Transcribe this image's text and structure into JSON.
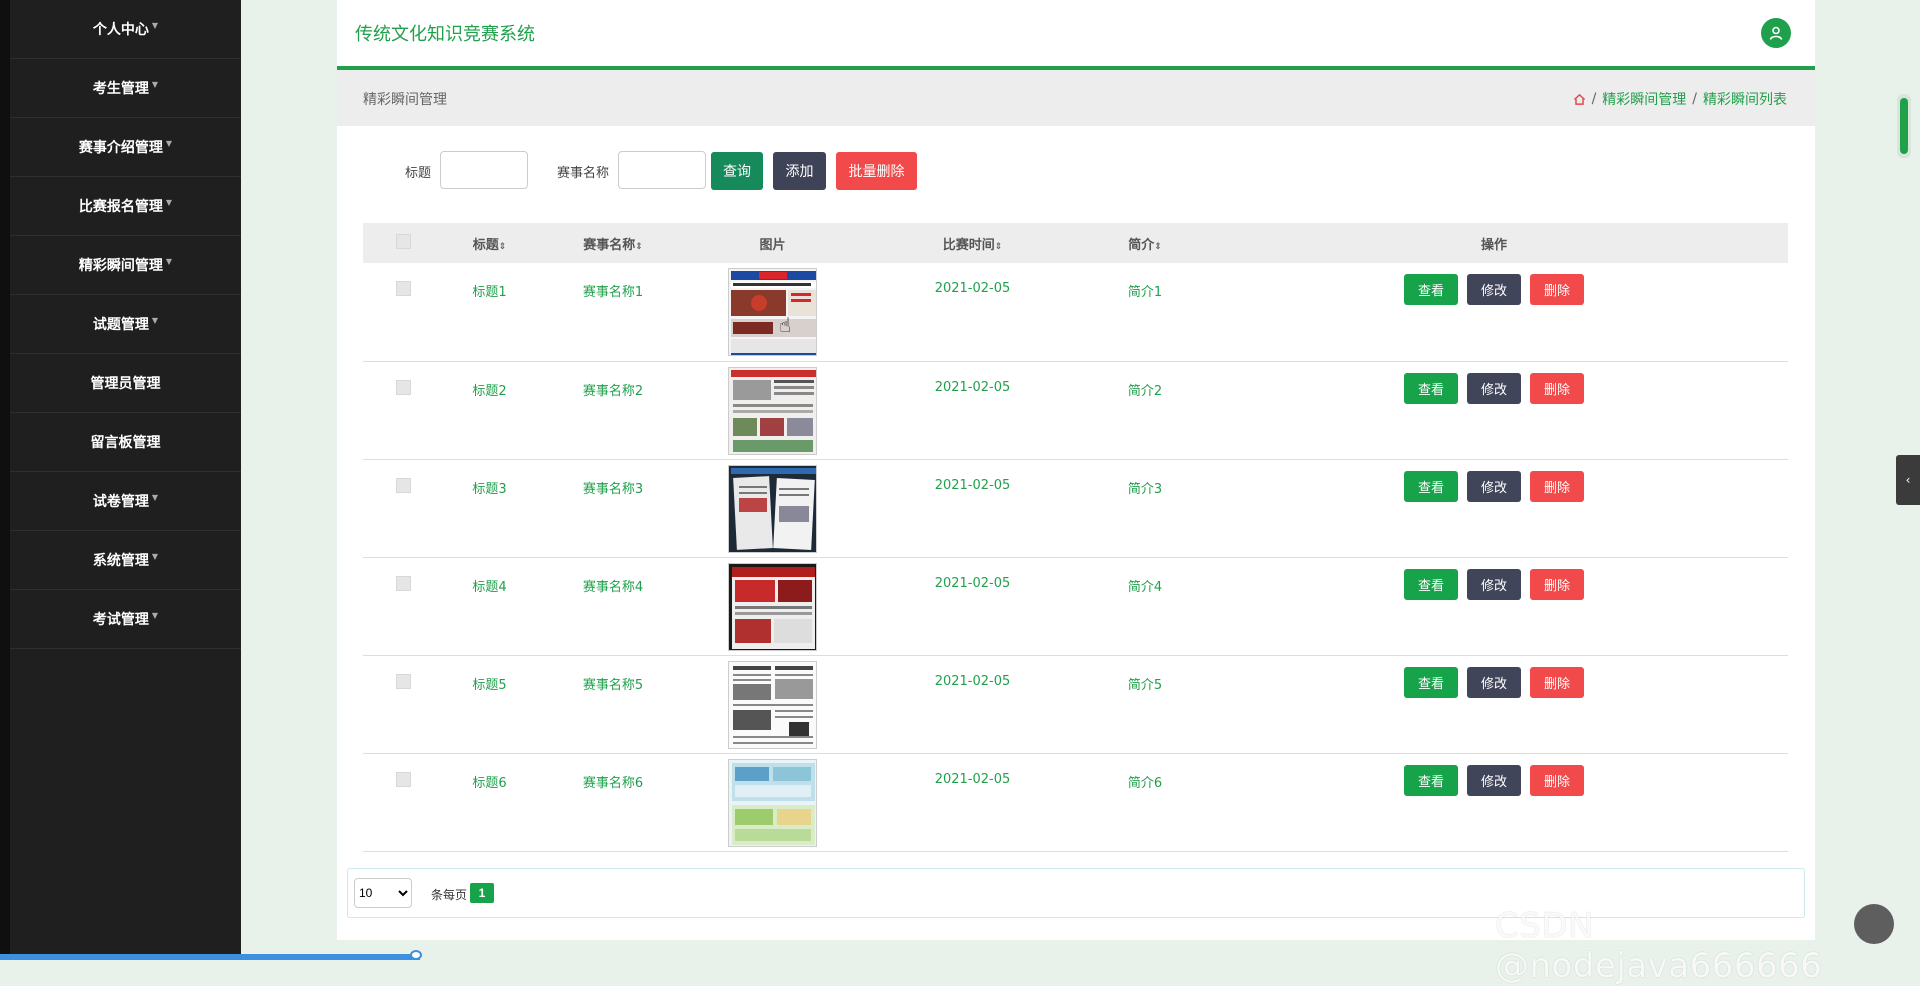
{
  "sidebar": {
    "items": [
      {
        "label": "个人中心"
      },
      {
        "label": "考生管理"
      },
      {
        "label": "赛事介绍管理"
      },
      {
        "label": "比赛报名管理"
      },
      {
        "label": "精彩瞬间管理"
      },
      {
        "label": "试题管理"
      },
      {
        "label": "管理员管理"
      },
      {
        "label": "留言板管理"
      },
      {
        "label": "试卷管理"
      },
      {
        "label": "系统管理"
      },
      {
        "label": "考试管理"
      }
    ]
  },
  "header": {
    "title": "传统文化知识竞赛系统"
  },
  "page": {
    "title": "精彩瞬间管理",
    "breadcrumb": [
      "精彩瞬间管理",
      "精彩瞬间列表"
    ],
    "sep": "/"
  },
  "search": {
    "title_label": "标题",
    "title_value": "",
    "event_label": "赛事名称",
    "event_value": "",
    "query_button": "查询",
    "add_button": "添加",
    "batch_delete_button": "批量删除"
  },
  "table": {
    "columns": [
      "标题",
      "赛事名称",
      "图片",
      "比赛时间",
      "简介",
      "操作"
    ],
    "sort_glyph": "⇕",
    "rows": [
      {
        "title": "标题1",
        "event": "赛事名称1",
        "date": "2021-02-05",
        "intro": "简介1"
      },
      {
        "title": "标题2",
        "event": "赛事名称2",
        "date": "2021-02-05",
        "intro": "简介2"
      },
      {
        "title": "标题3",
        "event": "赛事名称3",
        "date": "2021-02-05",
        "intro": "简介3"
      },
      {
        "title": "标题4",
        "event": "赛事名称4",
        "date": "2021-02-05",
        "intro": "简介4"
      },
      {
        "title": "标题5",
        "event": "赛事名称5",
        "date": "2021-02-05",
        "intro": "简介5"
      },
      {
        "title": "标题6",
        "event": "赛事名称6",
        "date": "2021-02-05",
        "intro": "简介6"
      }
    ],
    "actions": {
      "view": "查看",
      "edit": "修改",
      "delete": "删除"
    }
  },
  "pagination": {
    "page_size": "10",
    "per_page_label": "条每页",
    "current_page": "1"
  },
  "watermark": "CSDN @nodejava666666",
  "icons": {
    "home": "home-icon",
    "user": "user-icon",
    "caret": "caret-down-icon",
    "collapse": "chevron-left-icon"
  },
  "colors": {
    "accent": "#21a04c",
    "danger": "#f24a4a",
    "dark": "#41455a",
    "sidebar": "#1f1f1f"
  }
}
